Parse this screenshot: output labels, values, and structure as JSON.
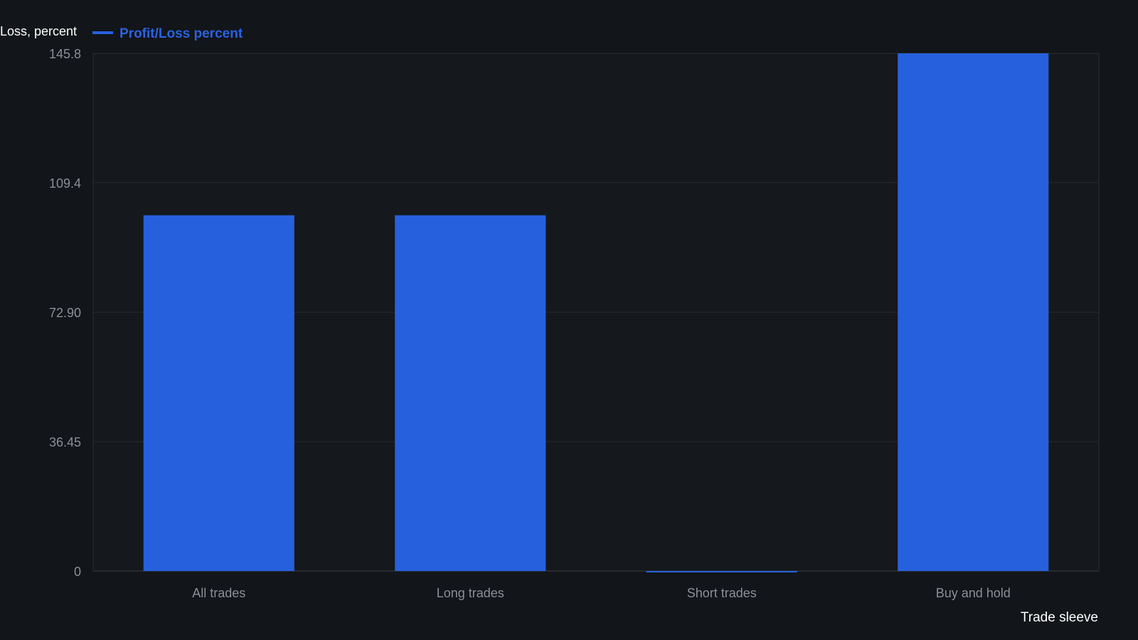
{
  "chart_data": {
    "type": "bar",
    "title": "",
    "ylabel": "Loss, percent",
    "xlabel": "Trade sleeve",
    "categories": [
      "All trades",
      "Long trades",
      "Short trades",
      "Buy and hold"
    ],
    "series": [
      {
        "name": "Profit/Loss percent",
        "values": [
          100.2,
          100.2,
          -0.3,
          145.8
        ]
      }
    ],
    "ylim": [
      0,
      145.8
    ],
    "yticks": [
      0,
      36.45,
      72.9,
      109.4,
      145.8
    ],
    "ytick_labels": [
      "0",
      "36.45",
      "72.90",
      "109.4",
      "145.8"
    ],
    "grid": true,
    "legend_position": "top-left"
  },
  "colors": {
    "background": "#121519",
    "plot_background": "#15181c",
    "bar": "#2660dc",
    "grid": "#262a30",
    "axis": "#3a3e45",
    "tick_label": "#8b8f96",
    "axis_label": "#ffffff",
    "legend_text": "#2a62e0"
  }
}
